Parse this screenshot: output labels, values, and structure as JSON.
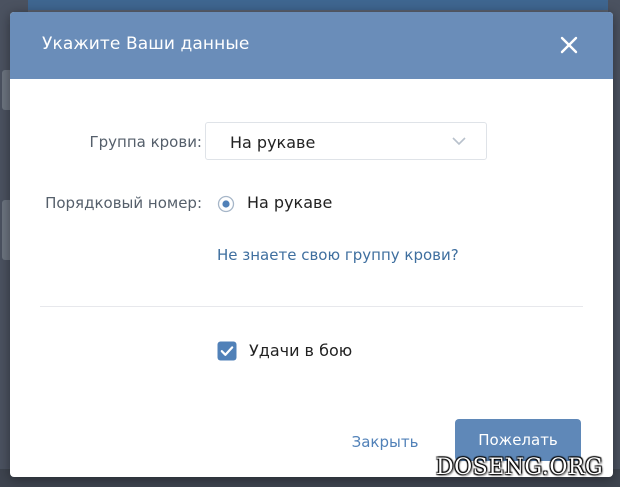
{
  "dialog": {
    "title": "Укажите Ваши данные",
    "close_icon": "close-icon"
  },
  "form": {
    "blood_group": {
      "label": "Группа крови:",
      "selected": "На рукаве"
    },
    "serial_number": {
      "label": "Порядковый номер:",
      "option": "На рукаве",
      "checked": true
    },
    "help_link": "Не знаете свою группу крови?",
    "wish": {
      "label": "Удачи в бою",
      "checked": true
    }
  },
  "buttons": {
    "close": "Закрыть",
    "submit": "Пожелать"
  },
  "watermark": "DOSENG.ORG",
  "colors": {
    "header": "#6a8db9",
    "primary_button": "#5f88b8",
    "link": "#3f6f9f"
  }
}
